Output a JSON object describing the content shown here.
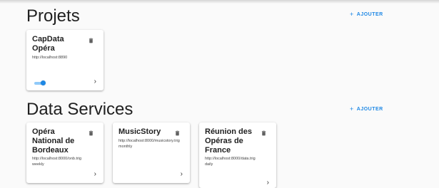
{
  "projets": {
    "title": "Projets",
    "add_label": "AJOUTER",
    "cards": [
      {
        "title": "CapData Opéra",
        "url": "http://localhost:8890",
        "toggle_on": true
      }
    ]
  },
  "services": {
    "title": "Data Services",
    "add_label": "AJOUTER",
    "cards": [
      {
        "title": "Opéra National de Bordeaux",
        "url": "http://localhost:8000/onb.trig",
        "frequency": "weekly"
      },
      {
        "title": "MusicStory",
        "url": "http://localhost:8000/musicstory.trig",
        "frequency": "monthly"
      },
      {
        "title": "Réunion des Opéras de France",
        "url": "http://localhost:8000/data.trig",
        "frequency": "daily"
      }
    ]
  },
  "icons": {
    "delete": "trash-icon",
    "open": "chevron-right-icon",
    "add": "plus-icon"
  },
  "colors": {
    "accent": "#1e88e5",
    "toggle_track": "#90caf9"
  }
}
